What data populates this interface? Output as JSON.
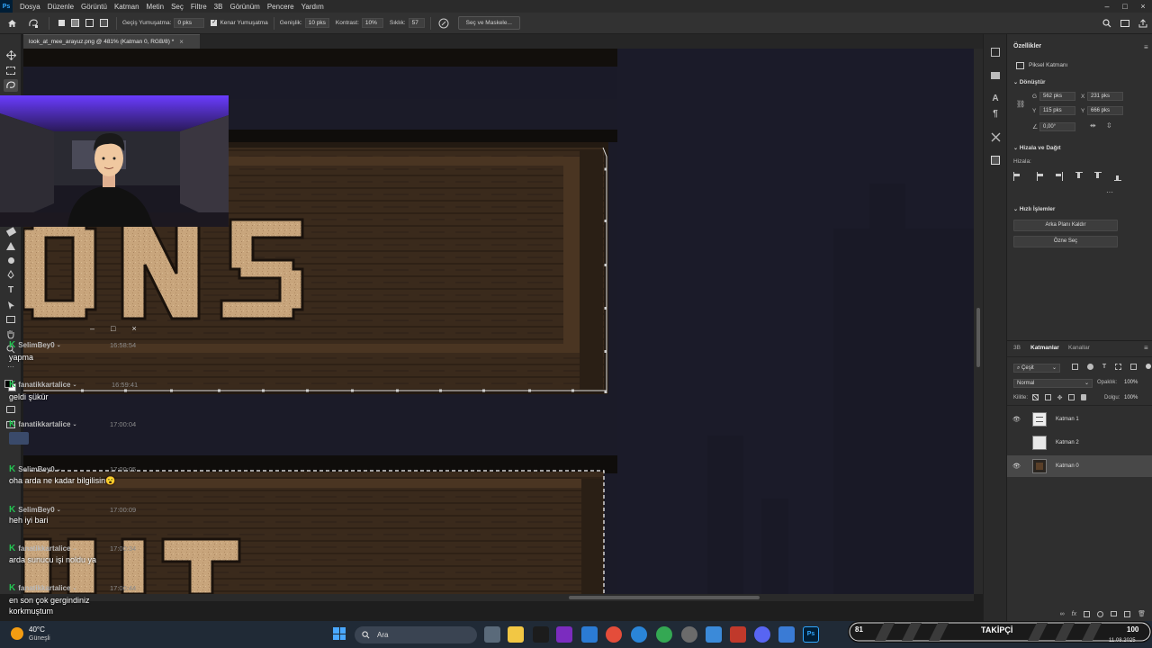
{
  "app": {
    "logo_text": "Ps"
  },
  "menu": {
    "items": [
      "Dosya",
      "Düzenle",
      "Görüntü",
      "Katman",
      "Metin",
      "Seç",
      "Filtre",
      "3B",
      "Görünüm",
      "Pencere",
      "Yardım"
    ]
  },
  "options_bar": {
    "feather_label": "Geçiş Yumuşatma:",
    "feather_value": "0 pks",
    "antialias_label": "Kenar Yumuşatma",
    "width_label": "Genişlik:",
    "width_value": "10 pks",
    "contrast_label": "Kontrast:",
    "contrast_value": "10%",
    "frequency_label": "Sıklık:",
    "frequency_value": "57",
    "select_mask_label": "Seç ve Maskele..."
  },
  "document": {
    "tab_title": "look_at_mee_arayuz.png @ 481% (Katman 0, RGB/8) *",
    "tab_close": "×"
  },
  "canvas_text": {
    "top_word": "ONS",
    "bottom_word": "UIT"
  },
  "properties": {
    "title": "Özellikler",
    "layer_kind": "Piksel Katmanı",
    "transform_title": "Dönüştür",
    "w_label": "G",
    "w_value": "562 pks",
    "x_label": "X",
    "x_value": "231 pks",
    "h_label": "Y",
    "h_value": "115 pks",
    "y_label": "Y",
    "y_value": "666 pks",
    "angle_value": "0,00°",
    "align_title": "Hizala ve Dağıt",
    "align_label": "Hizala:",
    "quick_title": "Hızlı İşlemler",
    "remove_bg": "Arka Planı Kaldır",
    "select_subject": "Özne Seç"
  },
  "layers_panel": {
    "tabs": [
      "3B",
      "Katmanlar",
      "Kanallar"
    ],
    "filter_kind": "Çeşit",
    "blend_mode": "Normal",
    "opacity_label": "Opaklık:",
    "opacity_value": "100%",
    "lock_label": "Kilitle:",
    "fill_label": "Dolgu:",
    "fill_value": "100%",
    "layers": [
      {
        "name": "Katman 1",
        "visible": true
      },
      {
        "name": "Katman 2",
        "visible": false
      },
      {
        "name": "Katman 0",
        "visible": true
      }
    ]
  },
  "chat": {
    "window_buttons": [
      "–",
      "□",
      "×"
    ],
    "messages": [
      {
        "user": "SelimBey0",
        "time": "16:58:54",
        "text": "yapma"
      },
      {
        "user": "fanatikkartalice",
        "time": "16:59:41",
        "text": "geldi şükür"
      },
      {
        "user": "fanatikkartalice",
        "time": "17:00:04",
        "text": ""
      },
      {
        "user": "SelimBey0",
        "time": "17:00:05",
        "text": "oha arda ne kadar bilgilisin😮"
      },
      {
        "user": "SelimBey0",
        "time": "17:00:09",
        "text": "heh iyi bari"
      },
      {
        "user": "fanatikkartalice",
        "time": "17:00:34",
        "text": "arda sunucu işi noldu ya"
      },
      {
        "user": "fanatikkartalice",
        "time": "17:00:44",
        "text": "en son çok gergindiniz korkmuştum"
      }
    ]
  },
  "taskbar": {
    "weather_temp": "40°C",
    "weather_desc": "Güneşli",
    "search_placeholder": "Ara",
    "follower_left": "81",
    "follower_label": "TAKİPÇİ",
    "follower_right": "100",
    "date": "11.08.2025"
  }
}
